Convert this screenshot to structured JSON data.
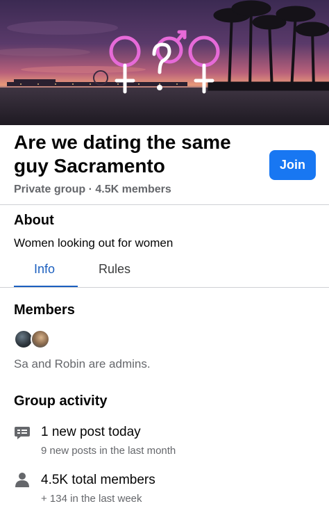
{
  "cover": {
    "image": "group-cover-beach-sunset-pier-palms",
    "symbols": [
      "female-symbol",
      "question-mark",
      "male-symbol",
      "female-symbol"
    ],
    "symbol_color": "#ffffff",
    "accent_color": "#e66ad8"
  },
  "group": {
    "name": "Are we dating the same guy Sacramento",
    "meta": "Private group · 4.5K members",
    "join_label": "Join"
  },
  "about": {
    "heading": "About",
    "description": "Women looking out for women"
  },
  "tabs": [
    {
      "label": "Info",
      "active": true
    },
    {
      "label": "Rules",
      "active": false
    }
  ],
  "members": {
    "heading": "Members",
    "admins_text": "Sa and Robin are admins."
  },
  "activity": {
    "heading": "Group activity",
    "items": [
      {
        "icon": "chat-bubble-icon",
        "main": "1 new post today",
        "sub": "9 new posts in the last month"
      },
      {
        "icon": "person-icon",
        "main": "4.5K total members",
        "sub": "+ 134 in the last week"
      }
    ]
  },
  "colors": {
    "primary": "#1877f2",
    "tab_active": "#1b5fbf",
    "secondary_text": "#65676b",
    "divider": "#ced0d4"
  }
}
